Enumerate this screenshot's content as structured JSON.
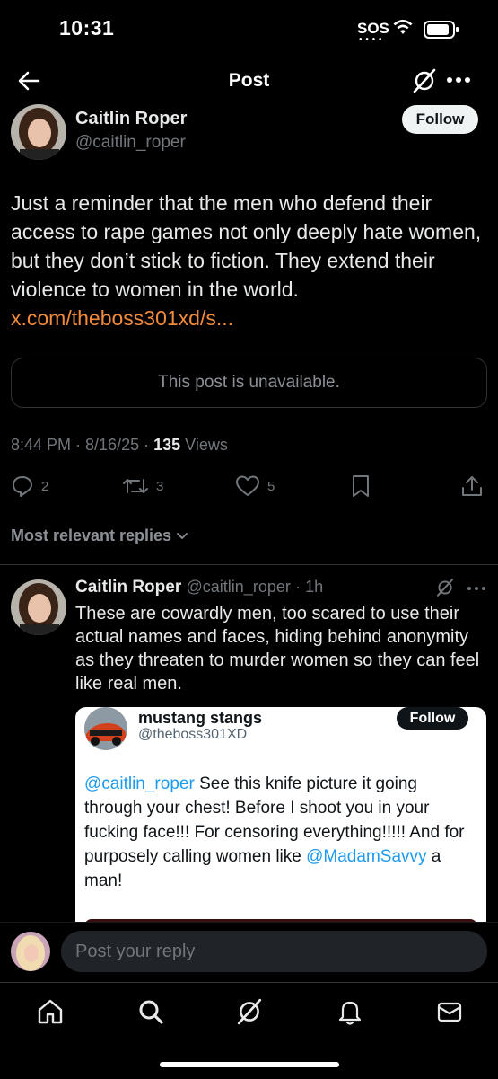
{
  "status_bar": {
    "time": "10:31",
    "sos": "SOS"
  },
  "nav": {
    "title": "Post"
  },
  "post": {
    "author_name": "Caitlin Roper",
    "author_handle": "@caitlin_roper",
    "follow_label": "Follow",
    "text": "Just a reminder that the men who defend their access to rape games not only deeply hate women, but they don’t stick to fiction. They extend their violence to women in the world. ",
    "link_text": "x.com/theboss301xd/s...",
    "unavailable_text": "This post is unavailable.",
    "timestamp": "8:44 PM · 8/16/25 · ",
    "views_count": "135",
    "views_label": " Views",
    "stats": {
      "replies": "2",
      "reposts": "3",
      "likes": "5"
    },
    "sort_label": "Most relevant replies"
  },
  "reply": {
    "author_name": "Caitlin Roper",
    "author_handle": "@caitlin_roper",
    "time": "· 1h",
    "text": "These are cowardly men, too scared to use their actual names and faces, hiding behind anonymity as they threaten to murder women so they can feel like real men.",
    "quote": {
      "name": "mustang stangs",
      "handle": "@theboss301XD",
      "follow_label": "Follow",
      "mention1": "@caitlin_roper",
      "text_part1": " See this knife picture it going through your chest!  Before I shoot you in your fucking face!!! For censoring everything!!!!! And for purposely calling women like ",
      "mention2": "@MadamSavvy",
      "text_part2": " a man!"
    }
  },
  "composer": {
    "placeholder": "Post your reply"
  },
  "colors": {
    "background": "#000000",
    "link": "#f28a3b",
    "mention": "#1d9bf0",
    "muted": "#71767b"
  }
}
